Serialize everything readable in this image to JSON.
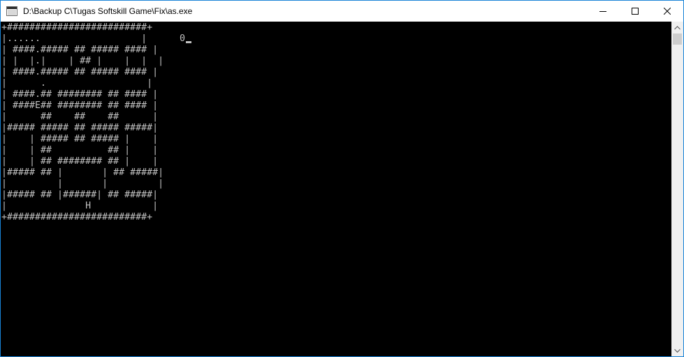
{
  "window": {
    "title": "D:\\Backup C\\Tugas Softskill Game\\Fix\\as.exe",
    "icon": "console-window-icon",
    "controls": [
      "minimize-icon",
      "maximize-icon",
      "close-icon"
    ]
  },
  "console": {
    "maze_lines": [
      "+#########################+",
      "|......                  |",
      "| ####.##### ## ##### #### |",
      "| |  |.|    | ## |    |  |  |",
      "| ####.##### ## ##### #### |",
      "|      .                  |",
      "| ####.## ######## ## #### |",
      "| ####E## ######## ## #### |",
      "|      ##    ##    ##      |",
      "|##### ##### ## ##### #####|",
      "|    | ##### ## ##### |    |",
      "|    | ##          ## |    |",
      "|    | ## ######## ## |    |",
      "|##### ## |       | ## #####|",
      "|         |       |         |",
      "|##### ## |######| ## #####|",
      "|              H           |",
      "+#########################+"
    ],
    "score": "0"
  },
  "colors": {
    "console_text": "#c0c0c0",
    "console_bg": "#000000",
    "window_border": "#1883d7"
  }
}
